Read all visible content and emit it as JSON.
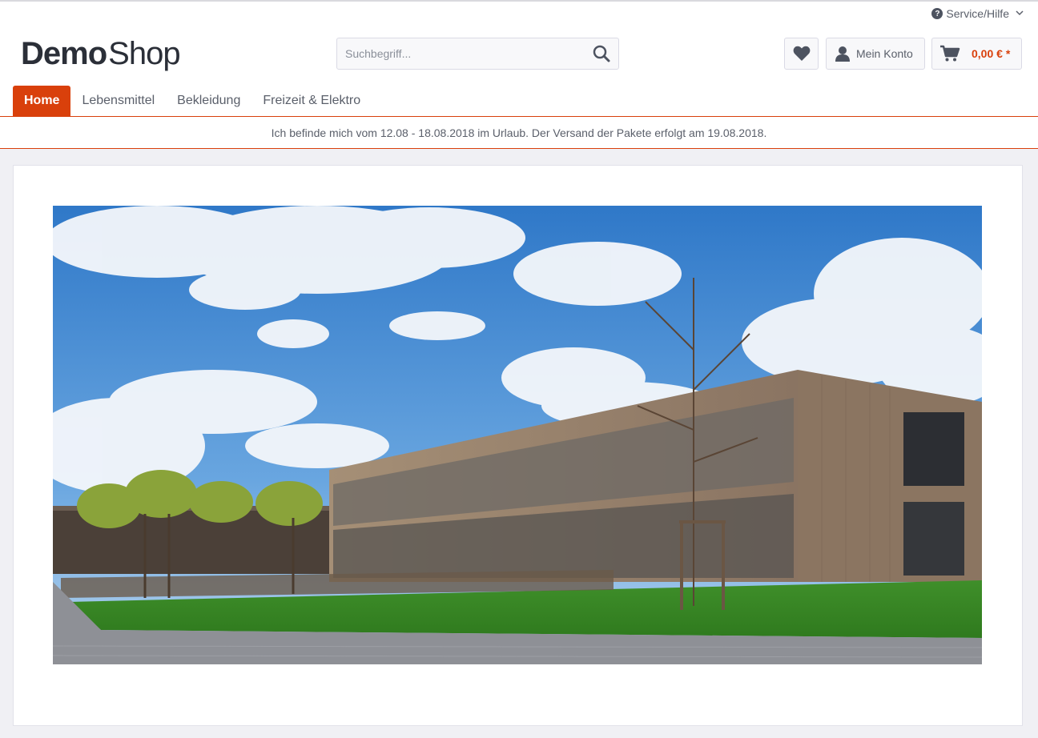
{
  "header": {
    "service_label": "Service/Hilfe",
    "logo_bold": "Demo",
    "logo_light": "Shop",
    "search_placeholder": "Suchbegriff...",
    "account_label": "Mein Konto",
    "cart_amount": "0,00 € *"
  },
  "nav": {
    "items": [
      {
        "label": "Home",
        "active": true
      },
      {
        "label": "Lebensmittel",
        "active": false
      },
      {
        "label": "Bekleidung",
        "active": false
      },
      {
        "label": "Freizeit & Elektro",
        "active": false
      }
    ]
  },
  "notice": {
    "text": "Ich befinde mich vom 12.08 - 18.08.2018 im Urlaub. Der Versand der Pakete erfolgt am 19.08.2018."
  },
  "colors": {
    "accent": "#d9400b",
    "text": "#5a5f6a",
    "logo": "#2b2f38",
    "page_bg": "#f0f0f4"
  },
  "icons": {
    "service": "question-circle-icon",
    "search": "search-icon",
    "wishlist": "heart-icon",
    "account": "user-icon",
    "cart": "cart-icon"
  }
}
